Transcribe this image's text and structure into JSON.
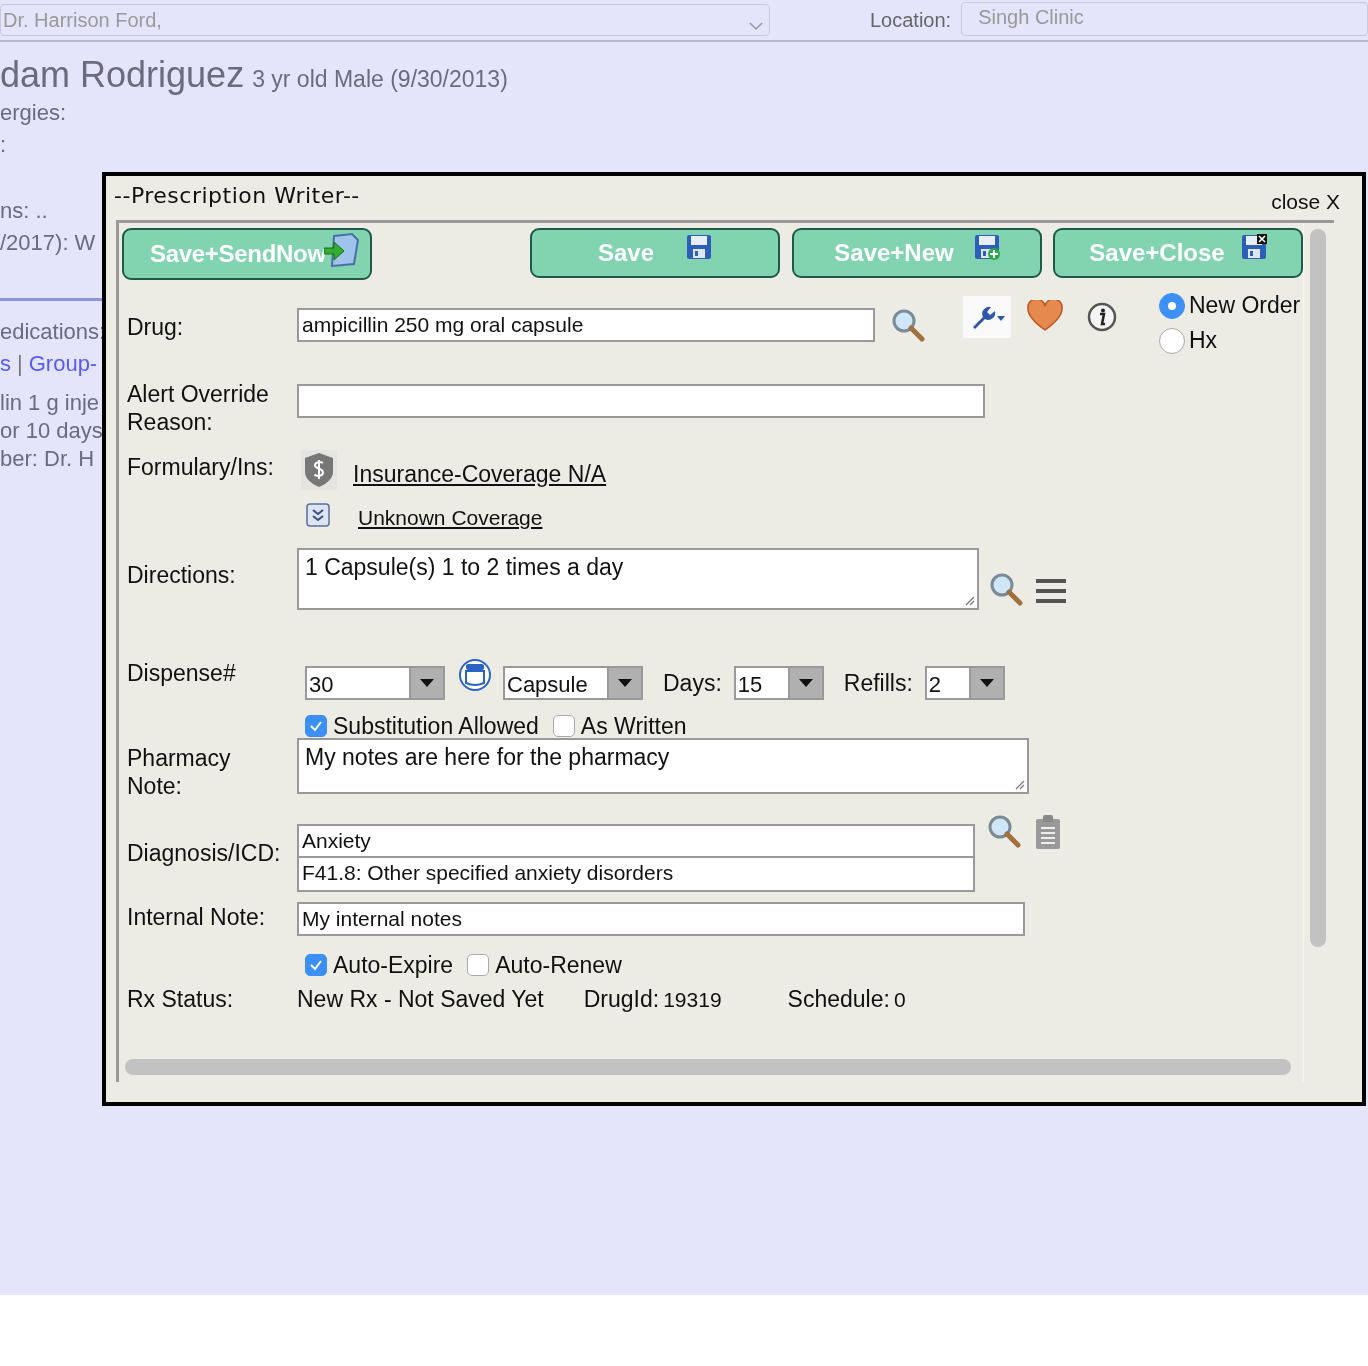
{
  "background": {
    "provider": "Dr. Harrison Ford,",
    "location_label": "Location:",
    "location": "Singh Clinic",
    "patient_name": "dam Rodriguez",
    "patient_info": "3 yr old Male (9/30/2013)",
    "upper_lines": [
      "ergies:",
      ":"
    ],
    "middle_lines": [
      "ns: ..",
      "/2017): W"
    ],
    "medications_heading": "edications:",
    "links": [
      "s",
      "Group-"
    ],
    "link_separator": "|",
    "lower_lines": [
      "lin 1 g inje",
      "or 10 days",
      "ber: Dr. H"
    ]
  },
  "dialog": {
    "title": "--Prescription Writer--",
    "close": "close X",
    "buttons": [
      {
        "label": "Save+SendNow"
      },
      {
        "label": "Save"
      },
      {
        "label": "Save+New"
      },
      {
        "label": "Save+Close"
      }
    ],
    "drug": {
      "label": "Drug:",
      "value": "ampicillin 250 mg oral capsule"
    },
    "order_types": [
      {
        "label": "New Order",
        "selected": true
      },
      {
        "label": "Hx",
        "selected": false
      }
    ],
    "alert_override": {
      "label_lines": [
        "Alert Override",
        "Reason:"
      ]
    },
    "formulary": {
      "label": "Formulary/Ins:",
      "insurance_link": "Insurance-Coverage N/A",
      "coverage_link": "Unknown Coverage"
    },
    "directions": {
      "label": "Directions:",
      "value": "1 Capsule(s) 1 to 2 times a day"
    },
    "dispense": {
      "label": "Dispense#",
      "quantity": "30",
      "unit": "Capsule",
      "days_label": "Days:",
      "days": "15",
      "refills_label": "Refills:",
      "refills": "2"
    },
    "substitution": [
      {
        "label": "Substitution Allowed",
        "checked": true
      },
      {
        "label": "As Written",
        "checked": false
      }
    ],
    "pharmacy_note": {
      "label_lines": [
        "Pharmacy",
        "Note:"
      ],
      "value": "My notes are here for the pharmacy"
    },
    "diagnosis": {
      "label": "Diagnosis/ICD:",
      "name": "Anxiety",
      "code": "F41.8: Other specified anxiety disorders"
    },
    "internal_note": {
      "label": "Internal Note:",
      "value": "My internal notes"
    },
    "expiry": [
      {
        "label": "Auto-Expire",
        "checked": true
      },
      {
        "label": "Auto-Renew",
        "checked": false
      }
    ],
    "rx_status": {
      "label": "Rx Status:",
      "status": "New Rx - Not Saved Yet",
      "drug_id_label": "DrugId:",
      "drug_id": "19319",
      "schedule_label": "Schedule:",
      "schedule": "0"
    }
  }
}
